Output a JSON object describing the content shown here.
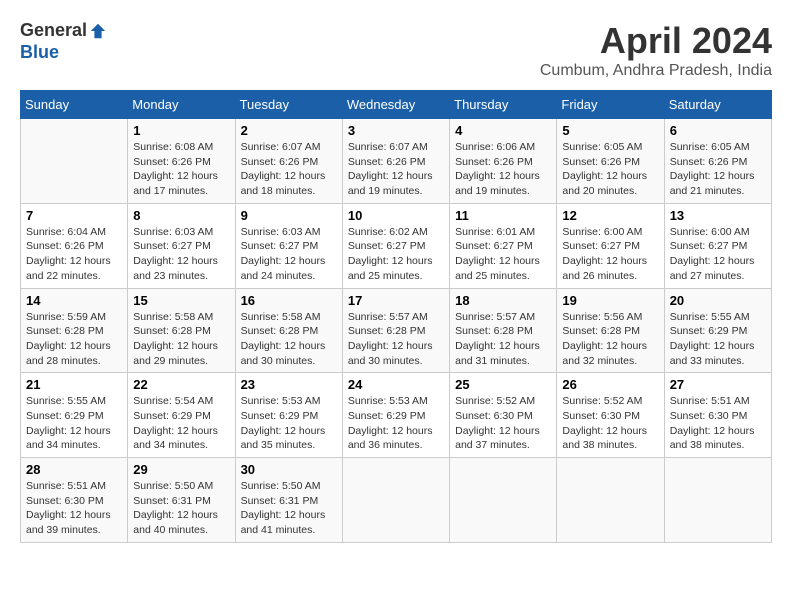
{
  "header": {
    "logo_line1": "General",
    "logo_line2": "Blue",
    "title": "April 2024",
    "location": "Cumbum, Andhra Pradesh, India"
  },
  "columns": [
    "Sunday",
    "Monday",
    "Tuesday",
    "Wednesday",
    "Thursday",
    "Friday",
    "Saturday"
  ],
  "weeks": [
    [
      {
        "day": "",
        "info": ""
      },
      {
        "day": "1",
        "info": "Sunrise: 6:08 AM\nSunset: 6:26 PM\nDaylight: 12 hours\nand 17 minutes."
      },
      {
        "day": "2",
        "info": "Sunrise: 6:07 AM\nSunset: 6:26 PM\nDaylight: 12 hours\nand 18 minutes."
      },
      {
        "day": "3",
        "info": "Sunrise: 6:07 AM\nSunset: 6:26 PM\nDaylight: 12 hours\nand 19 minutes."
      },
      {
        "day": "4",
        "info": "Sunrise: 6:06 AM\nSunset: 6:26 PM\nDaylight: 12 hours\nand 19 minutes."
      },
      {
        "day": "5",
        "info": "Sunrise: 6:05 AM\nSunset: 6:26 PM\nDaylight: 12 hours\nand 20 minutes."
      },
      {
        "day": "6",
        "info": "Sunrise: 6:05 AM\nSunset: 6:26 PM\nDaylight: 12 hours\nand 21 minutes."
      }
    ],
    [
      {
        "day": "7",
        "info": "Sunrise: 6:04 AM\nSunset: 6:26 PM\nDaylight: 12 hours\nand 22 minutes."
      },
      {
        "day": "8",
        "info": "Sunrise: 6:03 AM\nSunset: 6:27 PM\nDaylight: 12 hours\nand 23 minutes."
      },
      {
        "day": "9",
        "info": "Sunrise: 6:03 AM\nSunset: 6:27 PM\nDaylight: 12 hours\nand 24 minutes."
      },
      {
        "day": "10",
        "info": "Sunrise: 6:02 AM\nSunset: 6:27 PM\nDaylight: 12 hours\nand 25 minutes."
      },
      {
        "day": "11",
        "info": "Sunrise: 6:01 AM\nSunset: 6:27 PM\nDaylight: 12 hours\nand 25 minutes."
      },
      {
        "day": "12",
        "info": "Sunrise: 6:00 AM\nSunset: 6:27 PM\nDaylight: 12 hours\nand 26 minutes."
      },
      {
        "day": "13",
        "info": "Sunrise: 6:00 AM\nSunset: 6:27 PM\nDaylight: 12 hours\nand 27 minutes."
      }
    ],
    [
      {
        "day": "14",
        "info": "Sunrise: 5:59 AM\nSunset: 6:28 PM\nDaylight: 12 hours\nand 28 minutes."
      },
      {
        "day": "15",
        "info": "Sunrise: 5:58 AM\nSunset: 6:28 PM\nDaylight: 12 hours\nand 29 minutes."
      },
      {
        "day": "16",
        "info": "Sunrise: 5:58 AM\nSunset: 6:28 PM\nDaylight: 12 hours\nand 30 minutes."
      },
      {
        "day": "17",
        "info": "Sunrise: 5:57 AM\nSunset: 6:28 PM\nDaylight: 12 hours\nand 30 minutes."
      },
      {
        "day": "18",
        "info": "Sunrise: 5:57 AM\nSunset: 6:28 PM\nDaylight: 12 hours\nand 31 minutes."
      },
      {
        "day": "19",
        "info": "Sunrise: 5:56 AM\nSunset: 6:28 PM\nDaylight: 12 hours\nand 32 minutes."
      },
      {
        "day": "20",
        "info": "Sunrise: 5:55 AM\nSunset: 6:29 PM\nDaylight: 12 hours\nand 33 minutes."
      }
    ],
    [
      {
        "day": "21",
        "info": "Sunrise: 5:55 AM\nSunset: 6:29 PM\nDaylight: 12 hours\nand 34 minutes."
      },
      {
        "day": "22",
        "info": "Sunrise: 5:54 AM\nSunset: 6:29 PM\nDaylight: 12 hours\nand 34 minutes."
      },
      {
        "day": "23",
        "info": "Sunrise: 5:53 AM\nSunset: 6:29 PM\nDaylight: 12 hours\nand 35 minutes."
      },
      {
        "day": "24",
        "info": "Sunrise: 5:53 AM\nSunset: 6:29 PM\nDaylight: 12 hours\nand 36 minutes."
      },
      {
        "day": "25",
        "info": "Sunrise: 5:52 AM\nSunset: 6:30 PM\nDaylight: 12 hours\nand 37 minutes."
      },
      {
        "day": "26",
        "info": "Sunrise: 5:52 AM\nSunset: 6:30 PM\nDaylight: 12 hours\nand 38 minutes."
      },
      {
        "day": "27",
        "info": "Sunrise: 5:51 AM\nSunset: 6:30 PM\nDaylight: 12 hours\nand 38 minutes."
      }
    ],
    [
      {
        "day": "28",
        "info": "Sunrise: 5:51 AM\nSunset: 6:30 PM\nDaylight: 12 hours\nand 39 minutes."
      },
      {
        "day": "29",
        "info": "Sunrise: 5:50 AM\nSunset: 6:31 PM\nDaylight: 12 hours\nand 40 minutes."
      },
      {
        "day": "30",
        "info": "Sunrise: 5:50 AM\nSunset: 6:31 PM\nDaylight: 12 hours\nand 41 minutes."
      },
      {
        "day": "",
        "info": ""
      },
      {
        "day": "",
        "info": ""
      },
      {
        "day": "",
        "info": ""
      },
      {
        "day": "",
        "info": ""
      }
    ]
  ]
}
